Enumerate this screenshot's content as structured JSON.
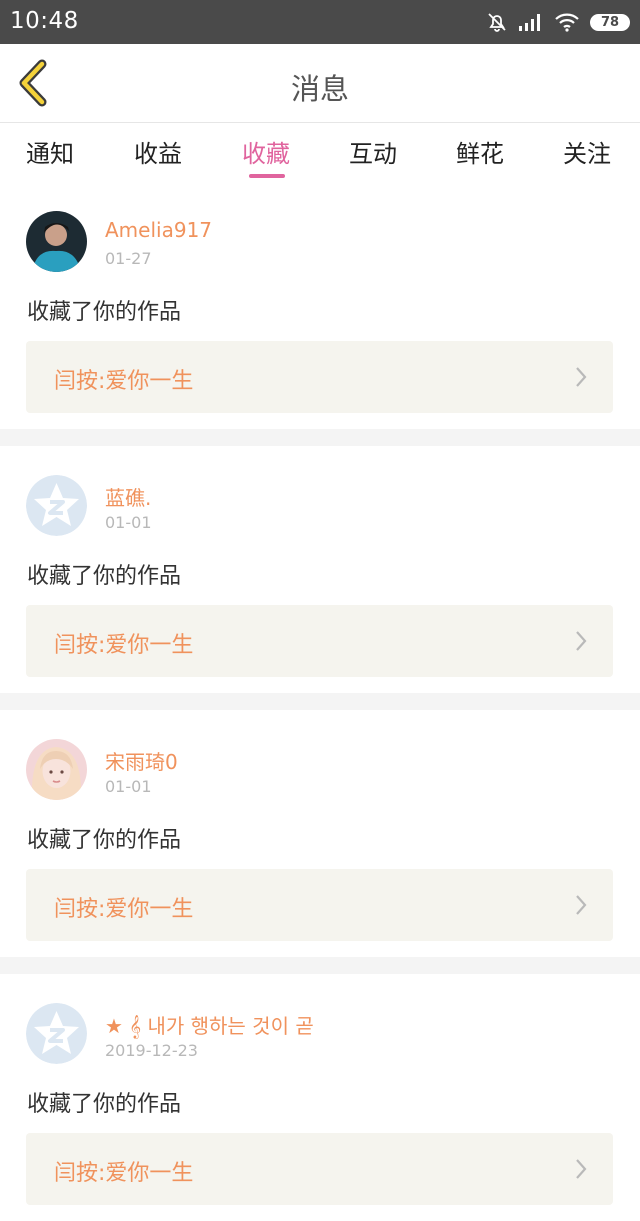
{
  "status_bar": {
    "time": "10:48",
    "battery": "78"
  },
  "header": {
    "title": "消息"
  },
  "tabs": [
    {
      "label": "通知"
    },
    {
      "label": "收益"
    },
    {
      "label": "收藏",
      "active": true
    },
    {
      "label": "互动"
    },
    {
      "label": "鲜花"
    },
    {
      "label": "关注"
    }
  ],
  "feed": [
    {
      "name": "Amelia917",
      "date": "01-27",
      "message": "收藏了你的作品",
      "work": "闫按:爱你一生",
      "avatar": "photo"
    },
    {
      "name": "蓝礁.",
      "date": "01-01",
      "message": "收藏了你的作品",
      "work": "闫按:爱你一生",
      "avatar": "default"
    },
    {
      "name": "宋雨琦0",
      "date": "01-01",
      "message": "收藏了你的作品",
      "work": "闫按:爱你一生",
      "avatar": "photo"
    },
    {
      "name": "★ 𝄞 내가 행하는 것이 곧",
      "date": "2019-12-23",
      "message": "收藏了你的作品",
      "work": "闫按:爱你一生",
      "avatar": "default"
    }
  ],
  "colors": {
    "accent": "#e0649e",
    "name": "#f0925c",
    "statusbar": "#4a4a4a"
  }
}
